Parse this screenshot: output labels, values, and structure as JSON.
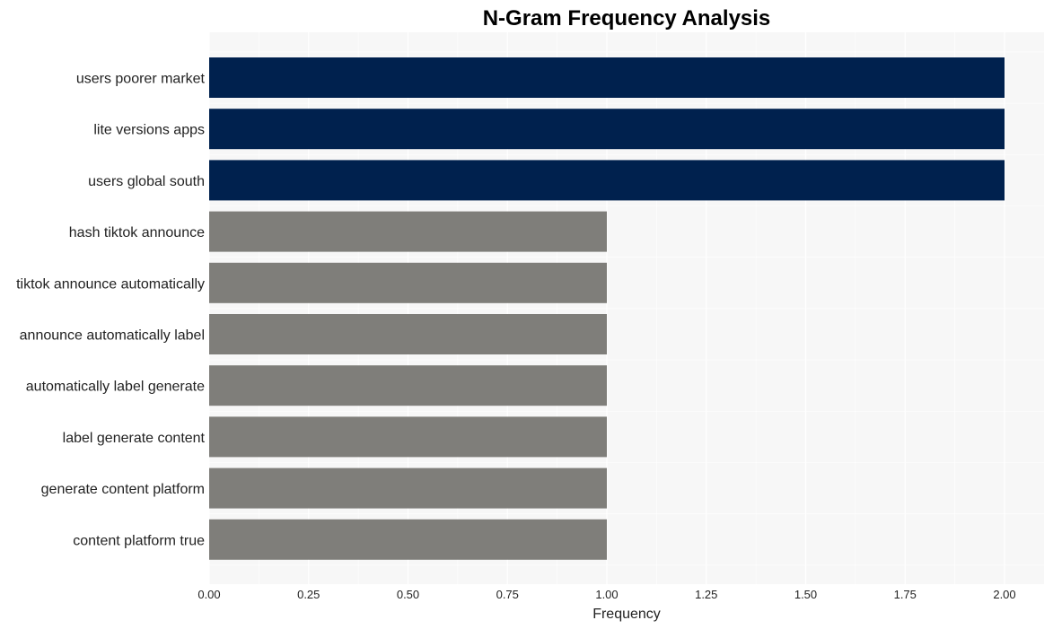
{
  "chart_data": {
    "type": "bar",
    "orientation": "horizontal",
    "title": "N-Gram Frequency Analysis",
    "xlabel": "Frequency",
    "ylabel": "",
    "xlim": [
      0,
      2.1
    ],
    "grid": true,
    "legend": "none",
    "x_ticks": [
      "0.00",
      "0.25",
      "0.50",
      "0.75",
      "1.00",
      "1.25",
      "1.50",
      "1.75",
      "2.00"
    ],
    "x_tick_values": [
      0,
      0.25,
      0.5,
      0.75,
      1.0,
      1.25,
      1.5,
      1.75,
      2.0
    ],
    "categories": [
      "users poorer market",
      "lite versions apps",
      "users global south",
      "hash tiktok announce",
      "tiktok announce automatically",
      "announce automatically label",
      "automatically label generate",
      "label generate content",
      "generate content platform",
      "content platform true"
    ],
    "values": [
      2,
      2,
      2,
      1,
      1,
      1,
      1,
      1,
      1,
      1
    ],
    "colors": {
      "highlight": "#00214e",
      "default": "#7f7e7a",
      "plot_background": "#f7f7f7",
      "grid": "#ffffff"
    }
  }
}
